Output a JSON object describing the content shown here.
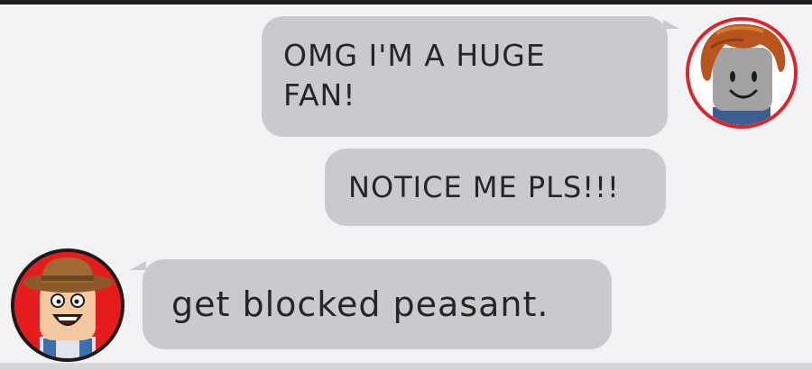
{
  "chat": {
    "messages": [
      {
        "sender": "fan",
        "side": "right",
        "text": "OMG I'M A HUGE FAN!"
      },
      {
        "sender": "fan",
        "side": "right",
        "text": "NOTICE ME PLS!!!"
      },
      {
        "sender": "replier",
        "side": "left",
        "text": "get blocked peasant."
      }
    ],
    "avatars": {
      "fan": {
        "icon": "bacon-hair-avatar-icon",
        "ring_color": "#e2222a"
      },
      "replier": {
        "icon": "cowboy-hat-avatar-icon",
        "ring_color": "#1a1a1a",
        "background": "#e61b1b"
      }
    },
    "bubble_color": "#c8cacd",
    "background_color": "#f1f2f4"
  }
}
